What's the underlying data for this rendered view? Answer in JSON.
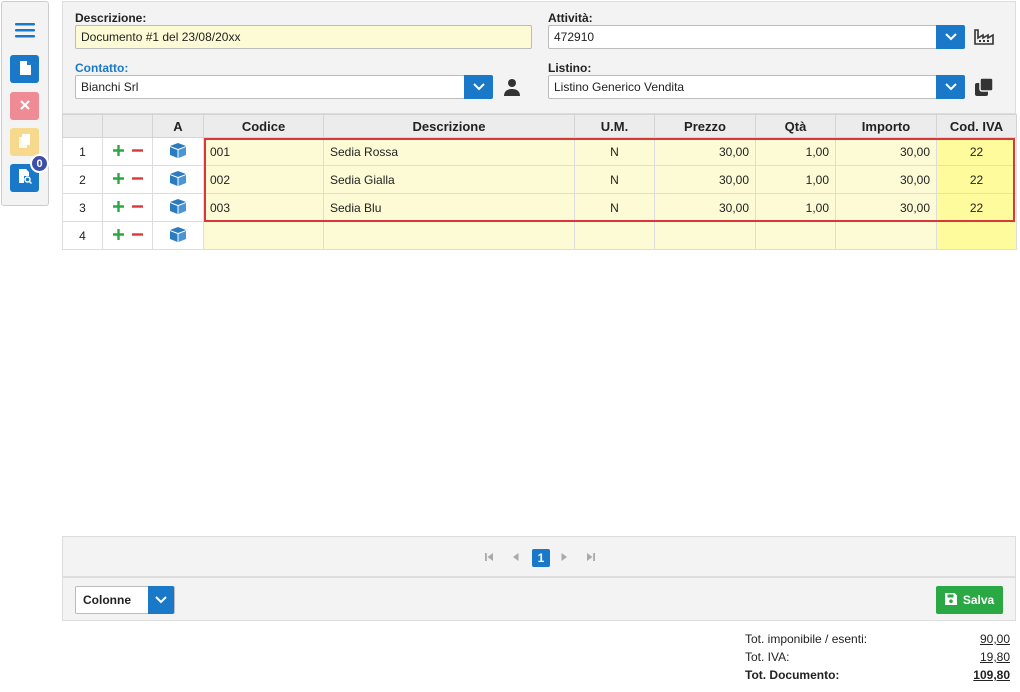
{
  "sidebar": {
    "menu_icon": "hamburger-icon",
    "new_icon": "document-icon",
    "delete_icon": "close-icon",
    "copy_icon": "copy-icon",
    "search_icon": "document-search-icon",
    "badge_count": "0"
  },
  "header": {
    "descrizione_label": "Descrizione:",
    "descrizione_value": "Documento #1 del 23/08/20xx",
    "attivita_label": "Attività:",
    "attivita_value": "472910",
    "contatto_label": "Contatto:",
    "contatto_value": "Bianchi Srl",
    "listino_label": "Listino:",
    "listino_value": "Listino Generico Vendita"
  },
  "grid": {
    "columns": [
      "",
      "",
      "A",
      "Codice",
      "Descrizione",
      "U.M.",
      "Prezzo",
      "Qtà",
      "Importo",
      "Cod. IVA"
    ],
    "rows": [
      {
        "n": "1",
        "codice": "001",
        "descrizione": "Sedia Rossa",
        "um": "N",
        "prezzo": "30,00",
        "qta": "1,00",
        "importo": "30,00",
        "iva": "22"
      },
      {
        "n": "2",
        "codice": "002",
        "descrizione": "Sedia Gialla",
        "um": "N",
        "prezzo": "30,00",
        "qta": "1,00",
        "importo": "30,00",
        "iva": "22"
      },
      {
        "n": "3",
        "codice": "003",
        "descrizione": "Sedia Blu",
        "um": "N",
        "prezzo": "30,00",
        "qta": "1,00",
        "importo": "30,00",
        "iva": "22"
      },
      {
        "n": "4",
        "codice": "",
        "descrizione": "",
        "um": "",
        "prezzo": "",
        "qta": "",
        "importo": "",
        "iva": ""
      }
    ]
  },
  "pager": {
    "current_page": "1"
  },
  "footer": {
    "columns_select": "Colonne",
    "save_label": "Salva"
  },
  "totals": {
    "imponibile_label": "Tot. imponibile / esenti:",
    "imponibile_value": "90,00",
    "iva_label": "Tot. IVA:",
    "iva_value": "19,80",
    "documento_label": "Tot. Documento:",
    "documento_value": "109,80"
  },
  "colors": {
    "primary": "#1a78c9",
    "danger": "#ef8b94",
    "warning": "#f6d98c",
    "success": "#2aa844",
    "selection_border": "#d9383a",
    "row_highlight": "#fdfbd5"
  }
}
